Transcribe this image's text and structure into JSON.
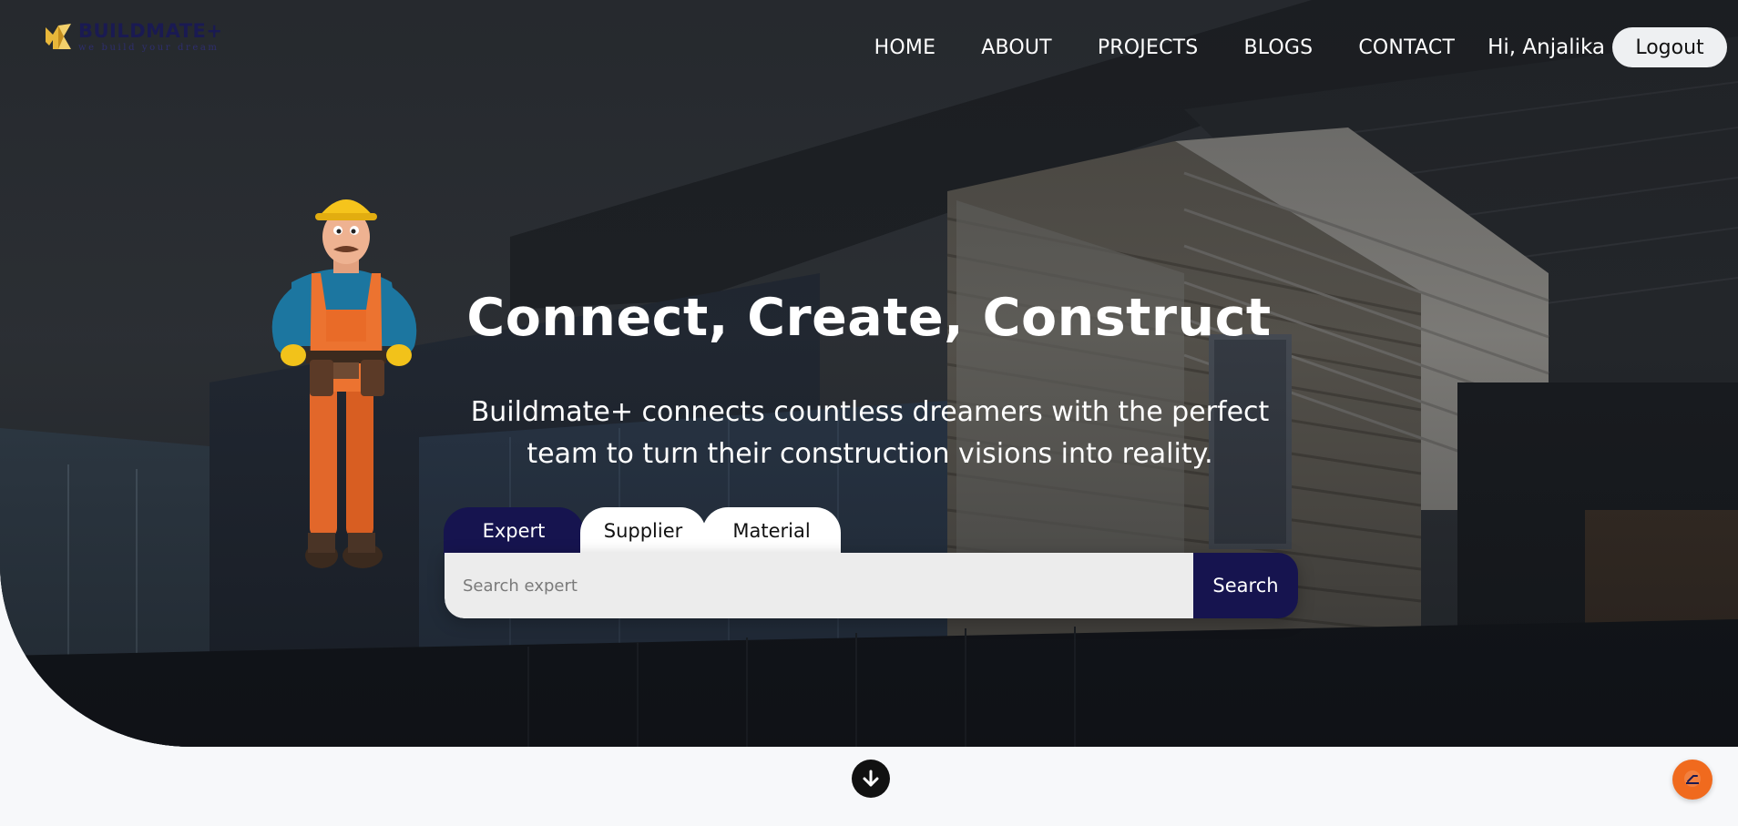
{
  "brand": {
    "name": "BUILDMATE+",
    "tagline": "we build your dream",
    "logo_icon": "buildmate-logo-icon"
  },
  "nav": {
    "links": [
      "HOME",
      "ABOUT",
      "PROJECTS",
      "BLOGS",
      "CONTACT"
    ],
    "greeting": "Hi, Anjalika",
    "logout_label": "Logout"
  },
  "hero": {
    "title": "Connect, Create, Construct",
    "subtitle_line1": "Buildmate+ connects countless dreamers with the perfect",
    "subtitle_line2": "team to turn their construction visions into reality.",
    "illustration": "construction-worker"
  },
  "search": {
    "tabs": [
      "Expert",
      "Supplier",
      "Material"
    ],
    "active_tab": "Expert",
    "placeholder": "Search expert",
    "value": "",
    "button_label": "Search"
  },
  "footer": {
    "scroll_icon": "arrow-down-circle-icon",
    "chat_icon": "chat-bubble-icon"
  },
  "colors": {
    "primary": "#16144f",
    "accent": "#f06a1e",
    "logout_bg": "#eef0f2"
  }
}
